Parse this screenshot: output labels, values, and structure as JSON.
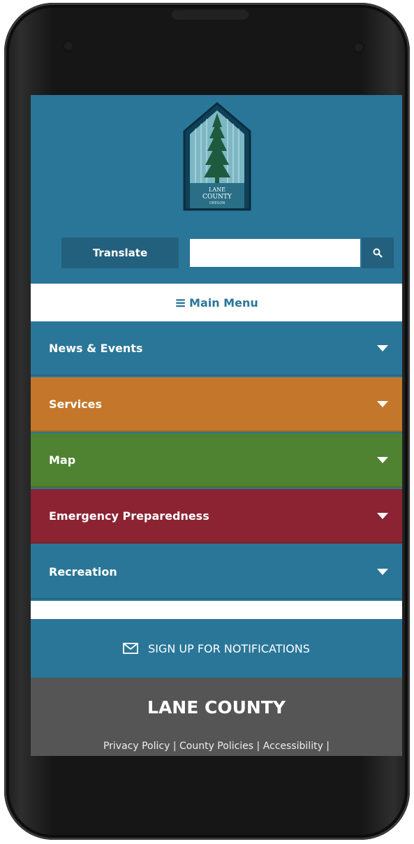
{
  "header": {
    "logo": {
      "line1": "LANE",
      "line2": "COUNTY",
      "line3": "OREGON"
    },
    "translate_label": "Translate",
    "search": {
      "placeholder": "",
      "value": "",
      "icon": "search-icon"
    }
  },
  "main_menu": {
    "label": "Main Menu",
    "icon": "hamburger-icon"
  },
  "menu_items": [
    {
      "label": "News & Events",
      "color": "#2a7698"
    },
    {
      "label": "Services",
      "color": "#c4772a"
    },
    {
      "label": "Map",
      "color": "#4f8231"
    },
    {
      "label": "Emergency Preparedness",
      "color": "#8c2332"
    },
    {
      "label": "Recreation",
      "color": "#2a7698"
    }
  ],
  "signup": {
    "label": "SIGN UP FOR NOTIFICATIONS",
    "icon": "envelope-icon"
  },
  "footer": {
    "title": "LANE COUNTY",
    "links": "Privacy Policy | County Policies | Accessibility |"
  },
  "colors": {
    "brand_blue": "#2a7698",
    "dark_blue": "#22607d",
    "footer_gray": "#555555"
  }
}
